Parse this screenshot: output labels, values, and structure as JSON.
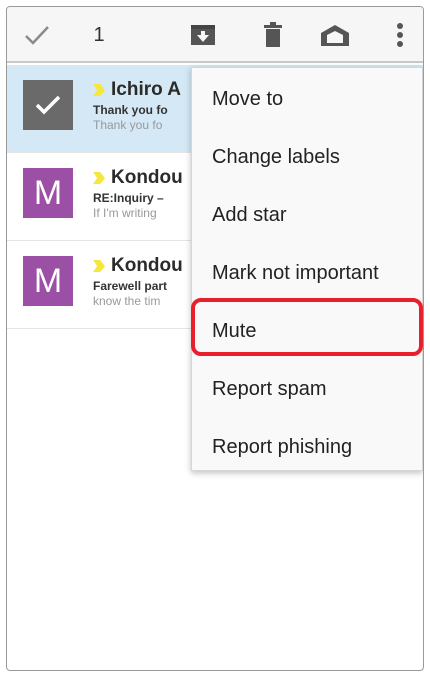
{
  "actionbar": {
    "done_icon": "check-icon",
    "selected_count": "1",
    "archive_icon": "archive-icon",
    "delete_icon": "trash-icon",
    "labels_icon": "label-icon",
    "overflow_icon": "more-vert-icon"
  },
  "mails": [
    {
      "sender": "Ichiro A",
      "subject": "Thank you fo",
      "snippet": "Thank you fo",
      "avatar": "",
      "selected": true
    },
    {
      "sender": "Kondou",
      "subject": "RE:Inquiry – ",
      "snippet": "If I'm writing",
      "avatar": "M",
      "selected": false
    },
    {
      "sender": "Kondou",
      "subject": "Farewell part",
      "snippet": "know the tim",
      "avatar": "M",
      "selected": false
    }
  ],
  "menu": {
    "items": [
      "Move to",
      "Change labels",
      "Add star",
      "Mark not important",
      "Mute",
      "Report spam",
      "Report phishing"
    ],
    "highlighted_index": 4
  },
  "colors": {
    "highlight": "#e8202e",
    "avatar": "#9b4fa5",
    "selected_row": "#d4e8f5",
    "importance": "#f6e73c"
  }
}
